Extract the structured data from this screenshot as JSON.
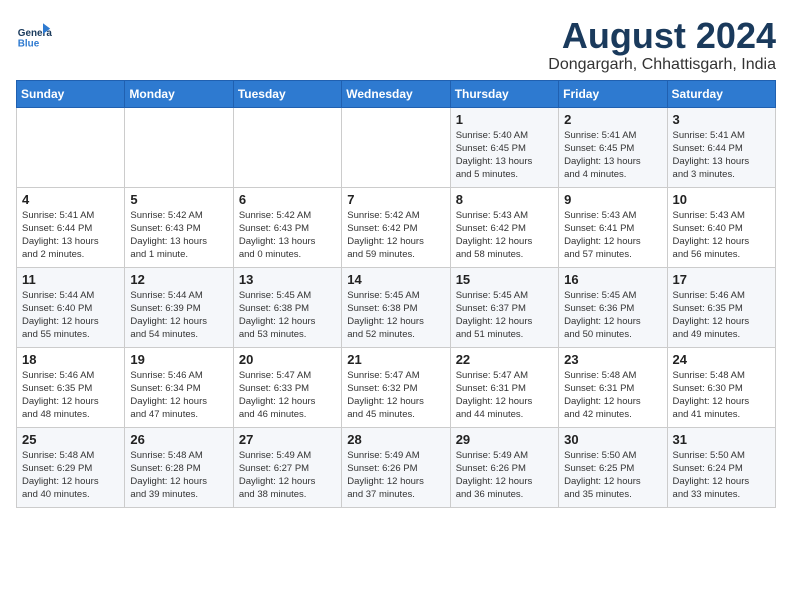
{
  "logo": {
    "line1": "General",
    "line2": "Blue"
  },
  "title": "August 2024",
  "subtitle": "Dongargarh, Chhattisgarh, India",
  "days_of_week": [
    "Sunday",
    "Monday",
    "Tuesday",
    "Wednesday",
    "Thursday",
    "Friday",
    "Saturday"
  ],
  "weeks": [
    [
      {
        "day": "",
        "info": ""
      },
      {
        "day": "",
        "info": ""
      },
      {
        "day": "",
        "info": ""
      },
      {
        "day": "",
        "info": ""
      },
      {
        "day": "1",
        "info": "Sunrise: 5:40 AM\nSunset: 6:45 PM\nDaylight: 13 hours\nand 5 minutes."
      },
      {
        "day": "2",
        "info": "Sunrise: 5:41 AM\nSunset: 6:45 PM\nDaylight: 13 hours\nand 4 minutes."
      },
      {
        "day": "3",
        "info": "Sunrise: 5:41 AM\nSunset: 6:44 PM\nDaylight: 13 hours\nand 3 minutes."
      }
    ],
    [
      {
        "day": "4",
        "info": "Sunrise: 5:41 AM\nSunset: 6:44 PM\nDaylight: 13 hours\nand 2 minutes."
      },
      {
        "day": "5",
        "info": "Sunrise: 5:42 AM\nSunset: 6:43 PM\nDaylight: 13 hours\nand 1 minute."
      },
      {
        "day": "6",
        "info": "Sunrise: 5:42 AM\nSunset: 6:43 PM\nDaylight: 13 hours\nand 0 minutes."
      },
      {
        "day": "7",
        "info": "Sunrise: 5:42 AM\nSunset: 6:42 PM\nDaylight: 12 hours\nand 59 minutes."
      },
      {
        "day": "8",
        "info": "Sunrise: 5:43 AM\nSunset: 6:42 PM\nDaylight: 12 hours\nand 58 minutes."
      },
      {
        "day": "9",
        "info": "Sunrise: 5:43 AM\nSunset: 6:41 PM\nDaylight: 12 hours\nand 57 minutes."
      },
      {
        "day": "10",
        "info": "Sunrise: 5:43 AM\nSunset: 6:40 PM\nDaylight: 12 hours\nand 56 minutes."
      }
    ],
    [
      {
        "day": "11",
        "info": "Sunrise: 5:44 AM\nSunset: 6:40 PM\nDaylight: 12 hours\nand 55 minutes."
      },
      {
        "day": "12",
        "info": "Sunrise: 5:44 AM\nSunset: 6:39 PM\nDaylight: 12 hours\nand 54 minutes."
      },
      {
        "day": "13",
        "info": "Sunrise: 5:45 AM\nSunset: 6:38 PM\nDaylight: 12 hours\nand 53 minutes."
      },
      {
        "day": "14",
        "info": "Sunrise: 5:45 AM\nSunset: 6:38 PM\nDaylight: 12 hours\nand 52 minutes."
      },
      {
        "day": "15",
        "info": "Sunrise: 5:45 AM\nSunset: 6:37 PM\nDaylight: 12 hours\nand 51 minutes."
      },
      {
        "day": "16",
        "info": "Sunrise: 5:45 AM\nSunset: 6:36 PM\nDaylight: 12 hours\nand 50 minutes."
      },
      {
        "day": "17",
        "info": "Sunrise: 5:46 AM\nSunset: 6:35 PM\nDaylight: 12 hours\nand 49 minutes."
      }
    ],
    [
      {
        "day": "18",
        "info": "Sunrise: 5:46 AM\nSunset: 6:35 PM\nDaylight: 12 hours\nand 48 minutes."
      },
      {
        "day": "19",
        "info": "Sunrise: 5:46 AM\nSunset: 6:34 PM\nDaylight: 12 hours\nand 47 minutes."
      },
      {
        "day": "20",
        "info": "Sunrise: 5:47 AM\nSunset: 6:33 PM\nDaylight: 12 hours\nand 46 minutes."
      },
      {
        "day": "21",
        "info": "Sunrise: 5:47 AM\nSunset: 6:32 PM\nDaylight: 12 hours\nand 45 minutes."
      },
      {
        "day": "22",
        "info": "Sunrise: 5:47 AM\nSunset: 6:31 PM\nDaylight: 12 hours\nand 44 minutes."
      },
      {
        "day": "23",
        "info": "Sunrise: 5:48 AM\nSunset: 6:31 PM\nDaylight: 12 hours\nand 42 minutes."
      },
      {
        "day": "24",
        "info": "Sunrise: 5:48 AM\nSunset: 6:30 PM\nDaylight: 12 hours\nand 41 minutes."
      }
    ],
    [
      {
        "day": "25",
        "info": "Sunrise: 5:48 AM\nSunset: 6:29 PM\nDaylight: 12 hours\nand 40 minutes."
      },
      {
        "day": "26",
        "info": "Sunrise: 5:48 AM\nSunset: 6:28 PM\nDaylight: 12 hours\nand 39 minutes."
      },
      {
        "day": "27",
        "info": "Sunrise: 5:49 AM\nSunset: 6:27 PM\nDaylight: 12 hours\nand 38 minutes."
      },
      {
        "day": "28",
        "info": "Sunrise: 5:49 AM\nSunset: 6:26 PM\nDaylight: 12 hours\nand 37 minutes."
      },
      {
        "day": "29",
        "info": "Sunrise: 5:49 AM\nSunset: 6:26 PM\nDaylight: 12 hours\nand 36 minutes."
      },
      {
        "day": "30",
        "info": "Sunrise: 5:50 AM\nSunset: 6:25 PM\nDaylight: 12 hours\nand 35 minutes."
      },
      {
        "day": "31",
        "info": "Sunrise: 5:50 AM\nSunset: 6:24 PM\nDaylight: 12 hours\nand 33 minutes."
      }
    ]
  ]
}
